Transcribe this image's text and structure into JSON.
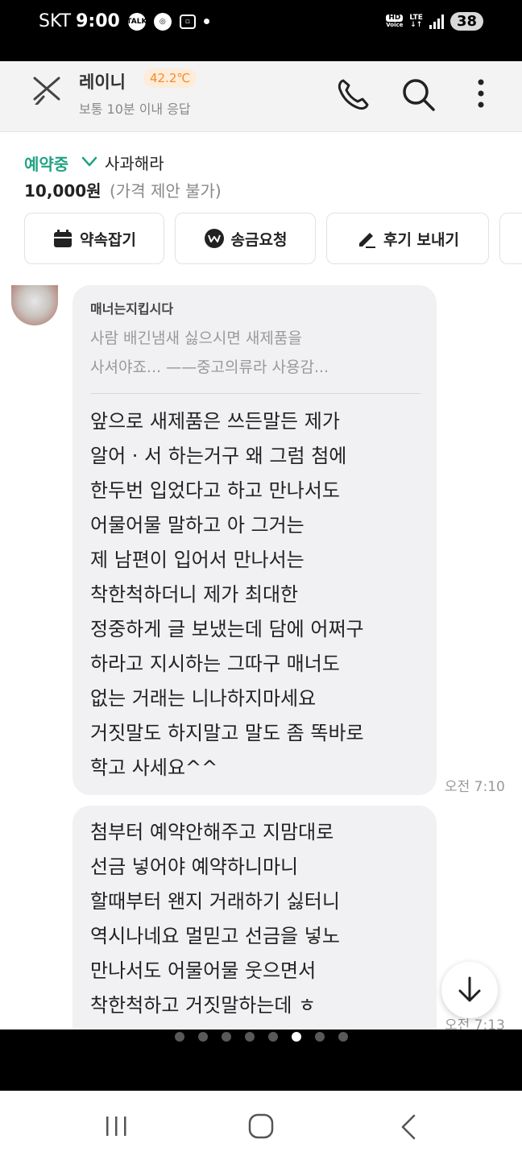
{
  "status_bar": {
    "carrier": "SKT",
    "time": "9:00",
    "icons": [
      "talk-icon",
      "notification-icon",
      "screenshot-icon"
    ],
    "talk_label": "TALK",
    "hd_label": "HD",
    "voice_label": "Voice",
    "lte_label": "LTE",
    "battery": "38"
  },
  "header": {
    "name": "레이니",
    "temperature": "42.2℃",
    "response": "보통 10분 이내 응답"
  },
  "product": {
    "status": "예약중",
    "title": "사과해라",
    "price": "10,000원",
    "price_note": "(가격 제안 불가)"
  },
  "actions": [
    {
      "label": "약속잡기",
      "icon": "calendar-icon"
    },
    {
      "label": "송금요청",
      "icon": "won-pay-icon"
    },
    {
      "label": "후기 보내기",
      "icon": "pencil-icon"
    }
  ],
  "messages": [
    {
      "quote_name": "매너는지킵시다",
      "quote_lines": [
        "사람 배긴냄새 싫으시면 새제품을",
        "사셔야죠... ——중고의류라 사용감..."
      ],
      "lines": [
        "앞으로 새제품은 쓰든말든 제가",
        "알어 · 서 하는거구 왜 그럼 첨에",
        "한두번 입었다고 하고 만나서도",
        "어물어물 말하고 아 그거는",
        "제 남편이 입어서 만나서는",
        "착한척하더니 제가 최대한",
        "정중하게 글 보냈는데 담에 어쩌구",
        "하라고 지시하는 그따구 매너도",
        "없는 거래는 니나하지마세요",
        "거짓말도 하지말고 말도 좀 똑바로",
        "학고 사세요^^"
      ],
      "time": "오전 7:10"
    },
    {
      "lines": [
        "첨부터 예약안해주고 지맘대로",
        "선금 넣어야 예약하니마니",
        "할때부터 왠지 거래하기 싫터니",
        "역시나네요  멀믿고 선금을 넣노",
        "만나서도 어물어물 웃으면서",
        "착한척하고 거짓말하는데 ㅎ"
      ],
      "time": "오전 7:13"
    }
  ],
  "page_indicator": {
    "count": 8,
    "active": 6
  },
  "nav_bar": [
    "recent-apps-icon",
    "home-icon",
    "back-icon"
  ]
}
